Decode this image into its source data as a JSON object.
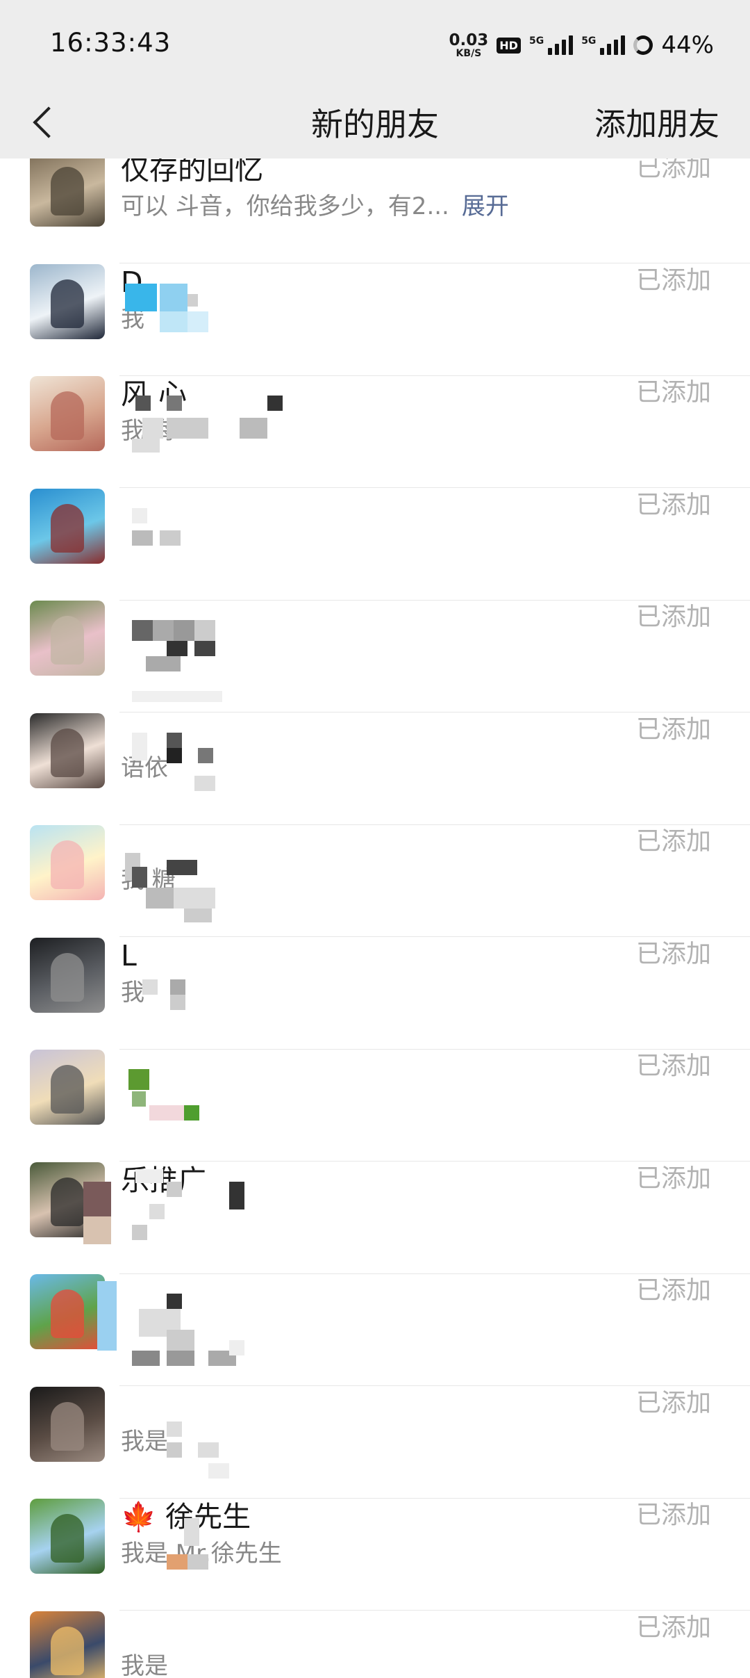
{
  "status_bar": {
    "time": "16:33:43",
    "net_speed": "0.03",
    "net_unit": "KB/S",
    "hd_badge": "HD",
    "sig1_label": "5G",
    "sig2_label": "5G",
    "battery": "44%"
  },
  "nav": {
    "title": "新的朋友",
    "action": "添加朋友",
    "back_icon": "chevron-left-icon"
  },
  "list": {
    "status_label": "已添加",
    "rows": [
      {
        "name": "仅存的回忆",
        "message": "可以 斗音，你给我多少，有2...",
        "expand": "展开",
        "avatar_colors": [
          "#7a6b55",
          "#c9b89e",
          "#4b4336"
        ]
      },
      {
        "name": "D",
        "message": "我",
        "avatar_colors": [
          "#9cb6cc",
          "#eef3f7",
          "#1f2738"
        ]
      },
      {
        "name": "风 心",
        "message": "我 海",
        "avatar_colors": [
          "#efe4d6",
          "#d8a78f",
          "#b5685a"
        ]
      },
      {
        "name": "",
        "message": "",
        "avatar_colors": [
          "#2a8fd0",
          "#6cc7e8",
          "#8a2c2c"
        ]
      },
      {
        "name": "",
        "message": "",
        "avatar_colors": [
          "#6b8a4e",
          "#e9c0c9",
          "#c2b6a4"
        ]
      },
      {
        "name": "",
        "message": "语依",
        "avatar_colors": [
          "#2b2b2b",
          "#efe0d6",
          "#5a4a44"
        ]
      },
      {
        "name": "",
        "message": "我 糖",
        "avatar_colors": [
          "#b9e3f2",
          "#fff3c9",
          "#f4b3b3"
        ]
      },
      {
        "name": "L",
        "message": "我",
        "avatar_colors": [
          "#1d1f22",
          "#5b5e63",
          "#8f8f8f"
        ]
      },
      {
        "name": "",
        "message": "",
        "avatar_colors": [
          "#c8c3d7",
          "#f0ddb8",
          "#565656"
        ]
      },
      {
        "name": "乐推广",
        "message": "",
        "avatar_colors": [
          "#4a5a3a",
          "#d8c2b0",
          "#2a2a2a"
        ]
      },
      {
        "name": "",
        "message": "",
        "avatar_colors": [
          "#6ab9e8",
          "#5fa34a",
          "#e84a3a"
        ]
      },
      {
        "name": "",
        "message": "我是",
        "avatar_colors": [
          "#1a1a1a",
          "#5a4c44",
          "#9a8a80"
        ]
      },
      {
        "name": "🍁 徐先生",
        "message": "我是 Mr.徐先生",
        "avatar_colors": [
          "#5e9d3e",
          "#a6d2f0",
          "#2f5e20"
        ]
      },
      {
        "name": "",
        "message": "我是",
        "avatar_colors": [
          "#d9843a",
          "#3a4a6a",
          "#f2c06a"
        ]
      }
    ]
  }
}
